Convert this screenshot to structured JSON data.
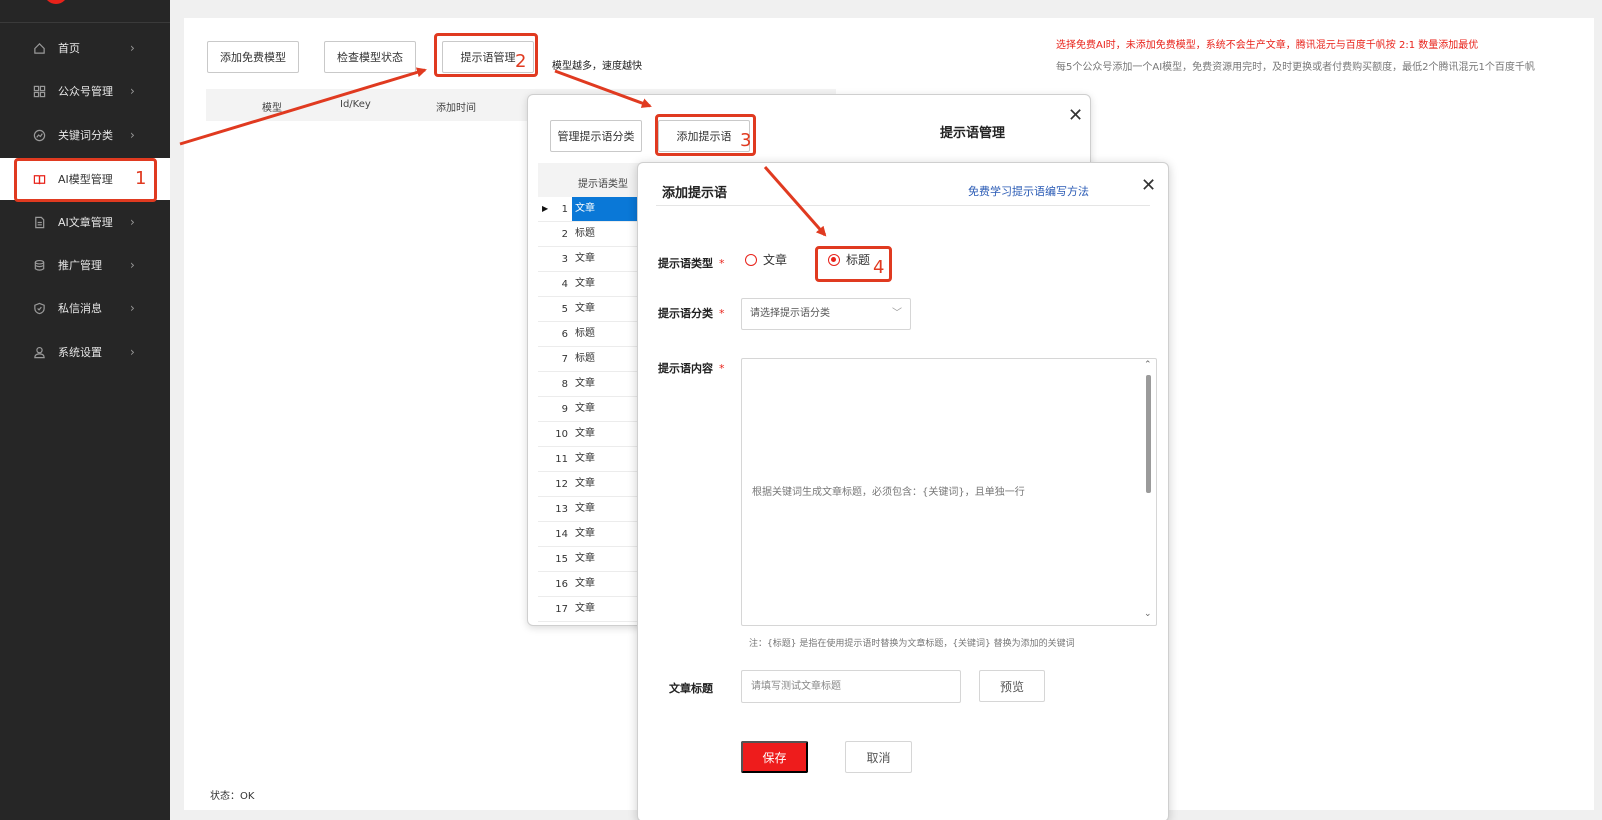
{
  "sidebar": {
    "items": [
      {
        "label": "首页",
        "icon": "home-icon"
      },
      {
        "label": "公众号管理",
        "icon": "grid-icon"
      },
      {
        "label": "关键词分类",
        "icon": "chart-icon"
      },
      {
        "label": "AI模型管理",
        "icon": "book-icon",
        "active": true
      },
      {
        "label": "AI文章管理",
        "icon": "document-icon"
      },
      {
        "label": "推广管理",
        "icon": "database-icon"
      },
      {
        "label": "私信消息",
        "icon": "shield-icon"
      },
      {
        "label": "系统设置",
        "icon": "user-icon"
      }
    ]
  },
  "toolbar": {
    "add_free_model": "添加免费模型",
    "check_model_status": "检查模型状态",
    "prompt_manage": "提示语管理",
    "tip": "模型越多，速度越快"
  },
  "notice": {
    "line1": "选择免费AI时，未添加免费模型，系统不会生产文章，腾讯混元与百度千帆按 2:1 数量添加最优",
    "line2": "每5个公众号添加一个AI模型，免费资源用完时，及时更换或者付费购买额度，最低2个腾讯混元1个百度千帆"
  },
  "model_table": {
    "columns": [
      "模型",
      "Id/Key",
      "添加时间"
    ]
  },
  "status": "状态：OK",
  "prompt_dialog": {
    "title": "提示语管理",
    "manage_category": "管理提示语分类",
    "add_prompt": "添加提示语",
    "column": "提示语类型",
    "rows": [
      {
        "idx": "1",
        "type": "文章"
      },
      {
        "idx": "2",
        "type": "标题"
      },
      {
        "idx": "3",
        "type": "文章"
      },
      {
        "idx": "4",
        "type": "文章"
      },
      {
        "idx": "5",
        "type": "文章"
      },
      {
        "idx": "6",
        "type": "标题"
      },
      {
        "idx": "7",
        "type": "标题"
      },
      {
        "idx": "8",
        "type": "文章"
      },
      {
        "idx": "9",
        "type": "文章"
      },
      {
        "idx": "10",
        "type": "文章"
      },
      {
        "idx": "11",
        "type": "文章"
      },
      {
        "idx": "12",
        "type": "文章"
      },
      {
        "idx": "13",
        "type": "文章"
      },
      {
        "idx": "14",
        "type": "文章"
      },
      {
        "idx": "15",
        "type": "文章"
      },
      {
        "idx": "16",
        "type": "文章"
      },
      {
        "idx": "17",
        "type": "文章"
      }
    ]
  },
  "add_dialog": {
    "title": "添加提示语",
    "learn_link": "免费学习提示语编写方法",
    "type_label": "提示语类型",
    "type_options": [
      "文章",
      "标题"
    ],
    "type_selected": "标题",
    "category_label": "提示语分类",
    "category_placeholder": "请选择提示语分类",
    "content_label": "提示语内容",
    "content_value": "根据关键词生成文章标题，必须包含：{关键词}，且单独一行",
    "note": "注：{标题} 是指在使用提示语时替换为文章标题，{关键词} 替换为添加的关键词",
    "title_label": "文章标题",
    "title_placeholder": "请填写测试文章标题",
    "preview": "预览",
    "save": "保存",
    "cancel": "取消",
    "required_mark": "*"
  },
  "annotations": [
    "1",
    "2",
    "3",
    "4"
  ],
  "colors": {
    "accent": "#e8221a",
    "annotation": "#e03a20",
    "selection": "#0a78d7",
    "link": "#2a5bb5",
    "sidebar_bg": "#262626"
  }
}
